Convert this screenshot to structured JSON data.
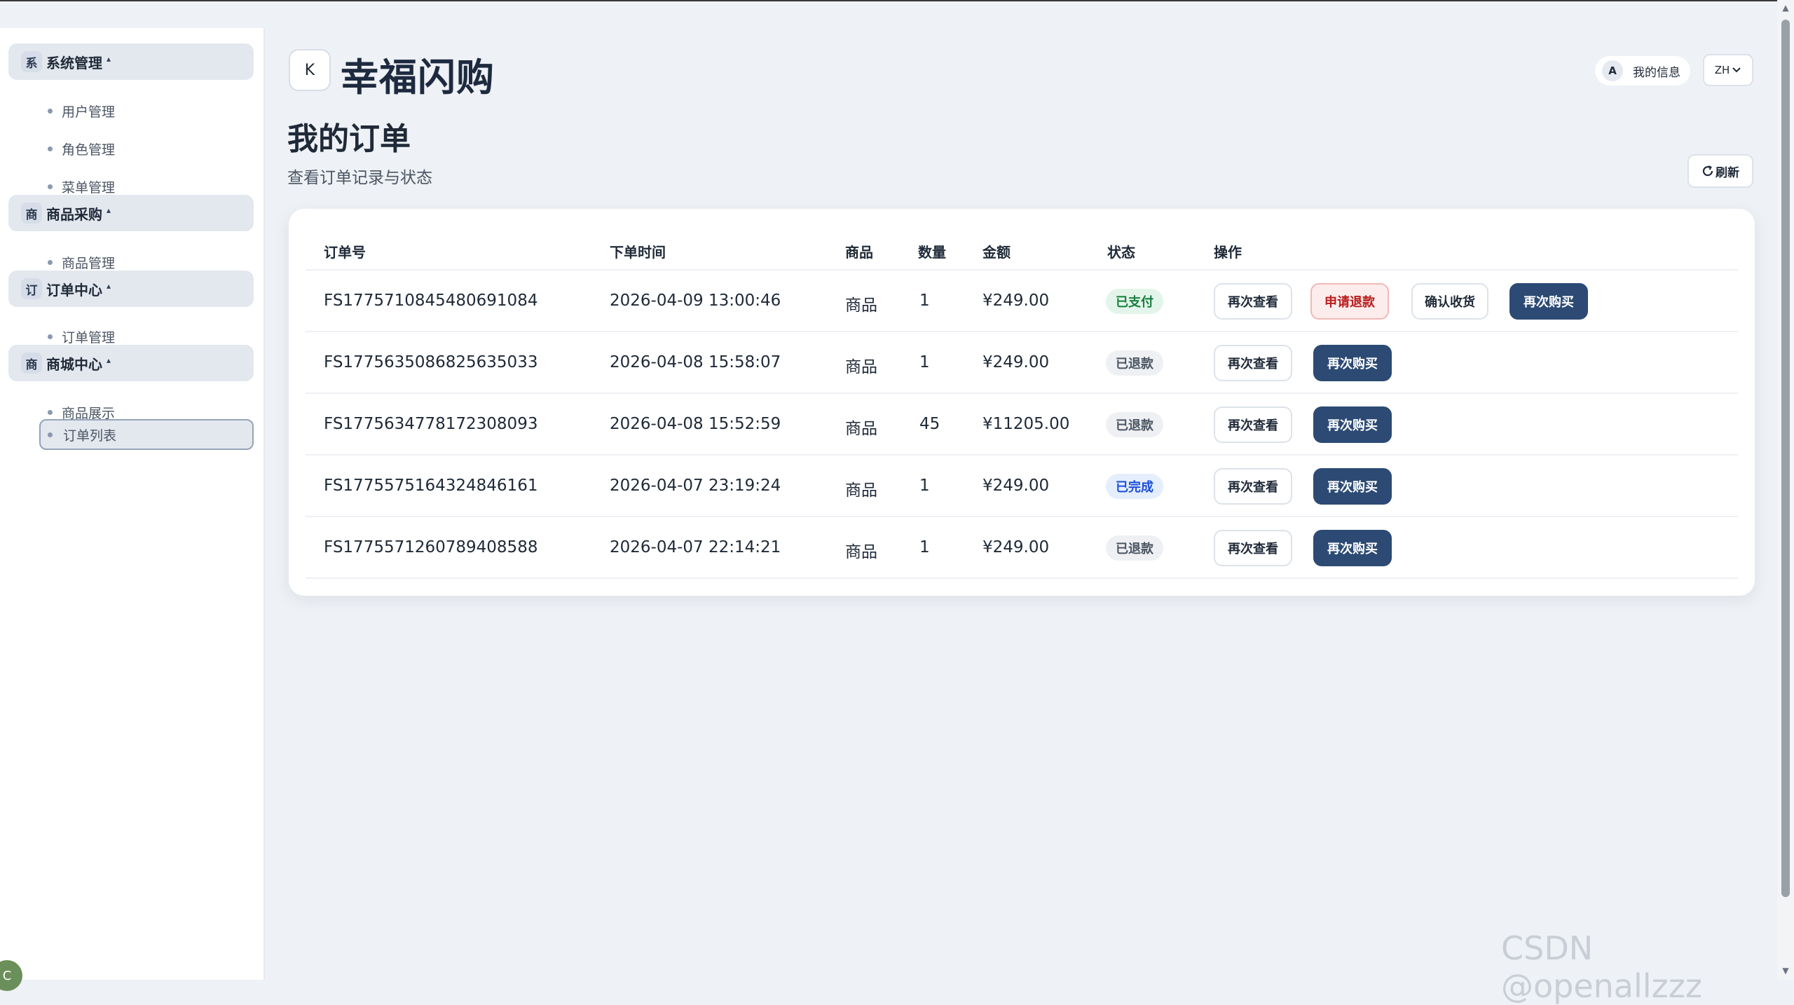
{
  "sidebar": {
    "groups": [
      {
        "badge": "系",
        "title": "系统管理",
        "caret": "▴",
        "items": [
          "用户管理",
          "角色管理",
          "菜单管理"
        ]
      },
      {
        "badge": "商",
        "title": "商品采购",
        "caret": "▴",
        "items": [
          "商品管理"
        ]
      },
      {
        "badge": "订",
        "title": "订单中心",
        "caret": "▴",
        "items": [
          "订单管理"
        ]
      },
      {
        "badge": "商",
        "title": "商城中心",
        "caret": "▴",
        "items": [
          "商品展示",
          "订单列表"
        ]
      }
    ],
    "corner_avatar": "C"
  },
  "header": {
    "brand_icon": "K",
    "brand_title": "幸福闪购",
    "myinfo_avatar": "A",
    "myinfo_label": "我的信息",
    "lang": "ZH"
  },
  "page": {
    "title": "我的订单",
    "subtitle": "查看订单记录与状态",
    "refresh_label": "刷新"
  },
  "table": {
    "columns": [
      "订单号",
      "下单时间",
      "商品",
      "数量",
      "金额",
      "状态",
      "操作"
    ],
    "rows": [
      {
        "order_no": "FS1775710845480691084",
        "time": "2026-04-09 13:00:46",
        "product": "商品",
        "qty": "1",
        "amount": "¥249.00",
        "status": "已支付",
        "status_kind": "paid",
        "actions": [
          "再次查看",
          "申请退款",
          "确认收货",
          "再次购买"
        ]
      },
      {
        "order_no": "FS1775635086825635033",
        "time": "2026-04-08 15:58:07",
        "product": "商品",
        "qty": "1",
        "amount": "¥249.00",
        "status": "已退款",
        "status_kind": "refunded",
        "actions": [
          "再次查看",
          "再次购买"
        ]
      },
      {
        "order_no": "FS1775634778172308093",
        "time": "2026-04-08 15:52:59",
        "product": "商品",
        "qty": "45",
        "amount": "¥11205.00",
        "status": "已退款",
        "status_kind": "refunded",
        "actions": [
          "再次查看",
          "再次购买"
        ]
      },
      {
        "order_no": "FS1775575164324846161",
        "time": "2026-04-07 23:19:24",
        "product": "商品",
        "qty": "1",
        "amount": "¥249.00",
        "status": "已完成",
        "status_kind": "done",
        "actions": [
          "再次查看",
          "再次购买"
        ]
      },
      {
        "order_no": "FS1775571260789408588",
        "time": "2026-04-07 22:14:21",
        "product": "商品",
        "qty": "1",
        "amount": "¥249.00",
        "status": "已退款",
        "status_kind": "refunded",
        "actions": [
          "再次查看",
          "再次购买"
        ]
      }
    ]
  },
  "watermark": "CSDN @openallzzz",
  "colors": {
    "primary": "#2c4a73",
    "paid": "#15803d",
    "done": "#1d4ed8",
    "refund": "#b91c1c"
  },
  "icons": {
    "refresh": "refresh-icon",
    "chevron": "chevron-down-icon",
    "scroll_up": "▲",
    "scroll_down": "▼"
  }
}
